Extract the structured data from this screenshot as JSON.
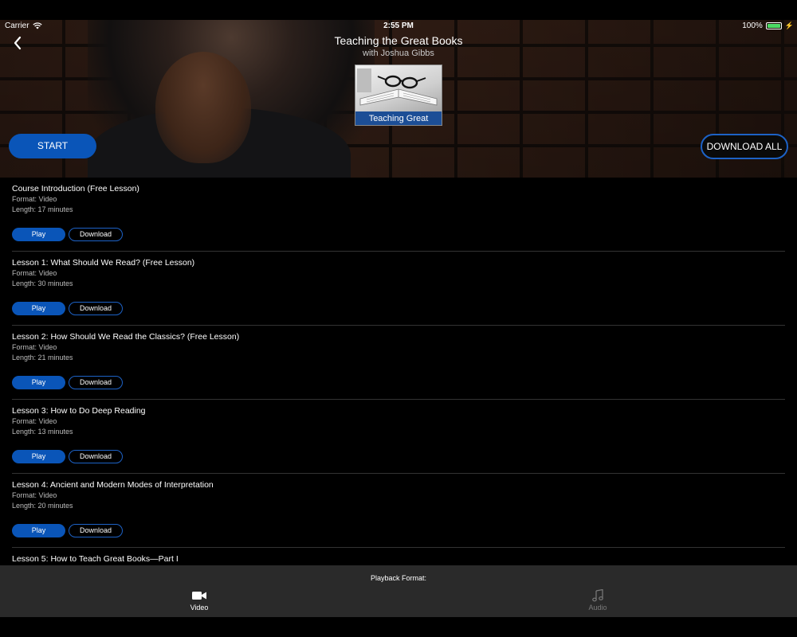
{
  "status_bar": {
    "carrier": "Carrier",
    "time": "2:55 PM",
    "battery": "100%",
    "battery_color": "#4cd964"
  },
  "header": {
    "title": "Teaching the Great Books",
    "subtitle": "with Joshua Gibbs",
    "cover_label": "Teaching Great Books",
    "back_icon": "chevron-left-icon"
  },
  "actions": {
    "start_label": "START",
    "download_all_label": "DOWNLOAD ALL"
  },
  "lessons": [
    {
      "title": "Course Introduction (Free Lesson)",
      "format": "Format: Video",
      "length": "Length: 17 minutes",
      "play_label": "Play",
      "download_label": "Download"
    },
    {
      "title": "Lesson 1: What Should We Read? (Free Lesson)",
      "format": "Format: Video",
      "length": "Length: 30 minutes",
      "play_label": "Play",
      "download_label": "Download"
    },
    {
      "title": "Lesson 2: How Should We Read the Classics? (Free Lesson)",
      "format": "Format: Video",
      "length": "Length: 21 minutes",
      "play_label": "Play",
      "download_label": "Download"
    },
    {
      "title": "Lesson 3: How to Do Deep Reading",
      "format": "Format: Video",
      "length": "Length: 13 minutes",
      "play_label": "Play",
      "download_label": "Download"
    },
    {
      "title": "Lesson 4: Ancient and Modern Modes of Interpretation",
      "format": "Format: Video",
      "length": "Length: 20 minutes",
      "play_label": "Play",
      "download_label": "Download"
    },
    {
      "title": "Lesson 5: How to Teach Great Books—Part I",
      "format": "",
      "length": "",
      "play_label": "",
      "download_label": ""
    }
  ],
  "playback": {
    "label": "Playback Format:",
    "tabs": [
      {
        "label": "Video",
        "icon": "video-camera-icon",
        "selected": true
      },
      {
        "label": "Audio",
        "icon": "music-note-icon",
        "selected": false
      }
    ]
  },
  "colors": {
    "accent": "#0a55b8",
    "accent_border": "#1d62c6",
    "cover_banner": "#1c4e96"
  }
}
